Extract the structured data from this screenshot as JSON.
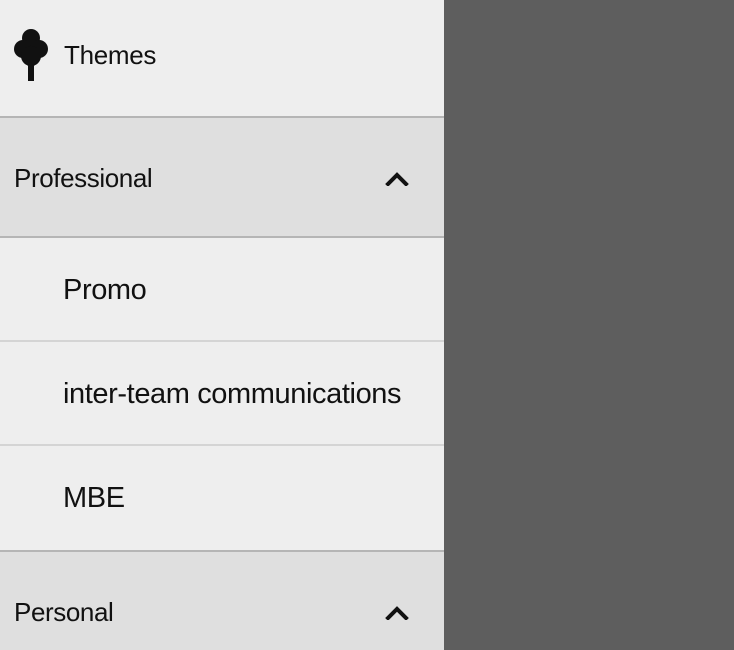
{
  "drawer": {
    "header": {
      "icon": "tree-icon",
      "title": "Themes"
    },
    "groups": [
      {
        "label": "Professional",
        "icon": "chevron-up-icon",
        "expanded": true,
        "items": [
          {
            "label": "Promo"
          },
          {
            "label": "inter-team communications"
          },
          {
            "label": "MBE"
          }
        ]
      },
      {
        "label": "Personal",
        "icon": "chevron-up-icon",
        "expanded": true
      }
    ]
  },
  "colors": {
    "drawer_background": "#eeeeee",
    "group_header_background": "#dfdfdf",
    "scrim": "#5e5e5e",
    "divider": "#b5b5b5",
    "text": "#111111"
  }
}
